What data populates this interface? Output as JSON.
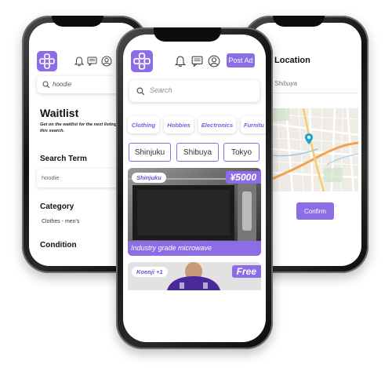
{
  "colors": {
    "accent": "#8d6de5",
    "frame": "#111111"
  },
  "left_screen": {
    "search_value": "hoodie",
    "title": "Waitlist",
    "description": "Get on the waitlist for the next listing matching this search.",
    "search_term_label": "Search Term",
    "search_term_value": "hoodie",
    "category_label": "Category",
    "category_value": "Clothes - men's",
    "condition_label": "Condition",
    "icons": [
      "bell-icon",
      "chat-icon",
      "profile-icon"
    ]
  },
  "center_screen": {
    "post_ad_label": "Post Ad",
    "search_placeholder": "Search",
    "categories": [
      "Clothing",
      "Hobbies",
      "Electronics",
      "Furnitu"
    ],
    "locations": [
      "Shinjuku",
      "Shibuya",
      "Tokyo"
    ],
    "listings": [
      {
        "location": "Shinjuku",
        "price": "¥5000",
        "title": "Industry grade microwave"
      },
      {
        "location": "Koenji +1",
        "price": "Free",
        "title": ""
      }
    ]
  },
  "right_screen": {
    "title": "Location",
    "search_value": "Shibuya",
    "confirm_label": "Confirm"
  }
}
